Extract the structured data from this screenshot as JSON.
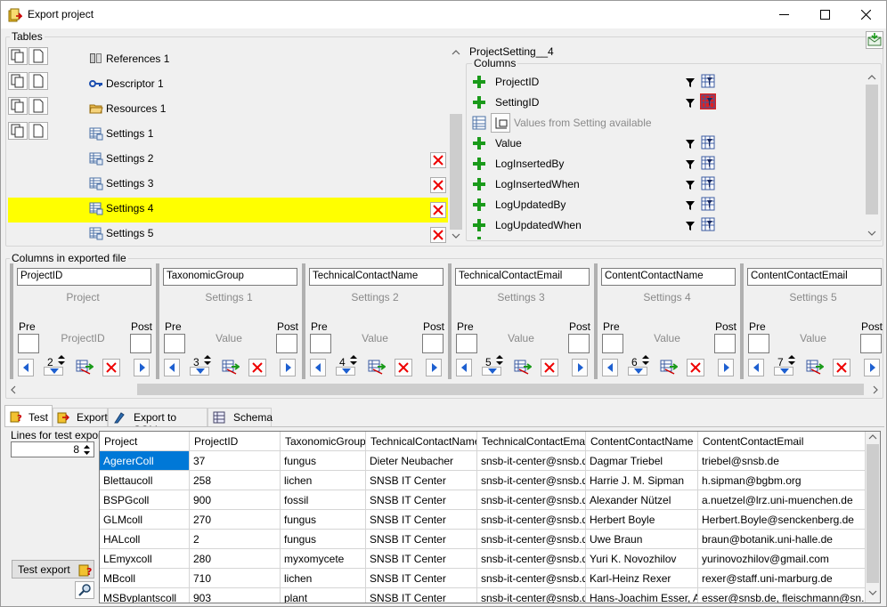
{
  "window": {
    "title": "Export project"
  },
  "tables_group": {
    "label": "Tables",
    "rows": [
      {
        "name": "References 1",
        "icon": "book-icon",
        "removable": false
      },
      {
        "name": "Descriptor 1",
        "icon": "key-icon",
        "removable": false
      },
      {
        "name": "Resources 1",
        "icon": "folder-icon",
        "removable": false
      },
      {
        "name": "Settings 1",
        "icon": "table-icon",
        "removable": false
      },
      {
        "name": "Settings 2",
        "icon": "table-icon",
        "removable": true
      },
      {
        "name": "Settings 3",
        "icon": "table-icon",
        "removable": true
      },
      {
        "name": "Settings 4",
        "icon": "table-icon",
        "removable": true,
        "selected": true
      },
      {
        "name": "Settings 5",
        "icon": "table-icon",
        "removable": true
      }
    ]
  },
  "detail": {
    "table_name": "ProjectSetting__4",
    "columns_label": "Columns",
    "columns": [
      {
        "name": "ProjectID"
      },
      {
        "name": "SettingID"
      },
      {
        "name": "Value"
      },
      {
        "name": "LogInsertedBy"
      },
      {
        "name": "LogInsertedWhen"
      },
      {
        "name": "LogUpdatedBy"
      },
      {
        "name": "LogUpdatedWhen"
      }
    ],
    "values_note": "Values from Setting available"
  },
  "exported": {
    "label": "Columns in exported file",
    "pre_label": "Pre",
    "post_label": "Post",
    "panels": [
      {
        "header": "ProjectID",
        "table": "Project",
        "column": "ProjectID",
        "pos": "2"
      },
      {
        "header": "TaxonomicGroup",
        "table": "Settings 1",
        "column": "Value",
        "pos": "3"
      },
      {
        "header": "TechnicalContactName",
        "table": "Settings 2",
        "column": "Value",
        "pos": "4"
      },
      {
        "header": "TechnicalContactEmail",
        "table": "Settings 3",
        "column": "Value",
        "pos": "5"
      },
      {
        "header": "ContentContactName",
        "table": "Settings 4",
        "column": "Value",
        "pos": "6"
      },
      {
        "header": "ContentContactEmail",
        "table": "Settings 5",
        "column": "Value",
        "pos": "7"
      }
    ]
  },
  "tabs": [
    {
      "label": "Test",
      "active": true,
      "icon": "test-icon"
    },
    {
      "label": "Export",
      "active": false,
      "icon": "export-icon"
    },
    {
      "label": "Export to SQLite",
      "active": false,
      "icon": "sqlite-icon"
    },
    {
      "label": "Schema",
      "active": false,
      "icon": "schema-icon"
    }
  ],
  "test": {
    "lines_label": "Lines for test export:",
    "lines_value": "8",
    "test_button": "Test export"
  },
  "grid": {
    "columns": [
      "Project",
      "ProjectID",
      "TaxonomicGroup",
      "TechnicalContactName",
      "TechnicalContactEmail",
      "ContentContactName",
      "ContentContactEmail"
    ],
    "rows": [
      [
        "AgererColl",
        "37",
        "fungus",
        "Dieter Neubacher",
        "snsb-it-center@snsb.de",
        "Dagmar Triebel",
        "triebel@snsb.de"
      ],
      [
        "Blettaucoll",
        "258",
        "lichen",
        "SNSB IT Center",
        "snsb-it-center@snsb.de",
        "Harrie J. M. Sipman",
        "h.sipman@bgbm.org"
      ],
      [
        "BSPGcoll",
        "900",
        "fossil",
        "SNSB IT Center",
        "snsb-it-center@snsb.de",
        "Alexander Nützel",
        "a.nuetzel@lrz.uni-muenchen.de"
      ],
      [
        "GLMcoll",
        "270",
        "fungus",
        "SNSB IT Center",
        "snsb-it-center@snsb.de",
        "Herbert Boyle",
        "Herbert.Boyle@senckenberg.de"
      ],
      [
        "HALcoll",
        "2",
        "fungus",
        "SNSB IT Center",
        "snsb-it-center@snsb.de",
        "Uwe Braun",
        "braun@botanik.uni-halle.de"
      ],
      [
        "LEmyxcoll",
        "280",
        "myxomycete",
        "SNSB IT Center",
        "snsb-it-center@snsb.de",
        "Yuri K. Novozhilov",
        "yurinovozhilov@gmail.com"
      ],
      [
        "MBcoll",
        "710",
        "lichen",
        "SNSB IT Center",
        "snsb-it-center@snsb.de",
        "Karl-Heinz Rexer",
        "rexer@staff.uni-marburg.de"
      ],
      [
        "MSBvplantscoll",
        "903",
        "plant",
        "SNSB IT Center",
        "snsb-it-center@snsb.de",
        "Hans-Joachim Esser, A...",
        "esser@snsb.de, fleischmann@sn..."
      ]
    ]
  }
}
